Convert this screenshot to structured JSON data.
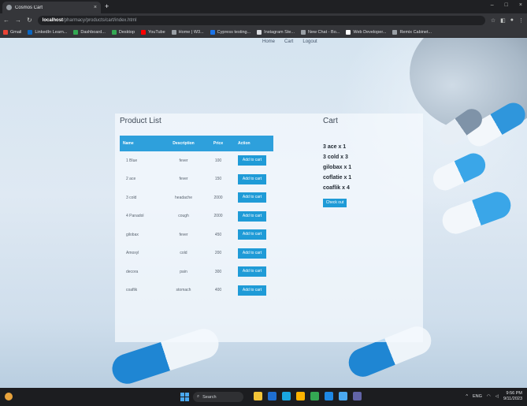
{
  "browser": {
    "tab_title": "Cosmos Cart",
    "tab_close": "×",
    "new_tab": "+",
    "address_host": "localhost",
    "address_path": "/pharmacy/products/cart/index.html",
    "window_controls": [
      "–",
      "□",
      "×"
    ],
    "nav_back": "←",
    "nav_forward": "→",
    "reload": "↻",
    "bookmarks": [
      {
        "label": "Gmail",
        "color": "#ea4335"
      },
      {
        "label": "LinkedIn Learn...",
        "color": "#0a66c2"
      },
      {
        "label": "Dashboard...",
        "color": "#34a853"
      },
      {
        "label": "Desktop",
        "color": "#34a853"
      },
      {
        "label": "YouTube",
        "color": "#ff0000"
      },
      {
        "label": "Home | W3...",
        "color": "#9aa0a6"
      },
      {
        "label": "Cypress testing...",
        "color": "#1a73e8"
      },
      {
        "label": "Instagram Ste...",
        "color": "#dadce0"
      },
      {
        "label": "New Chat - Bo...",
        "color": "#9aa0a6"
      },
      {
        "label": "Web Developer...",
        "color": "#ffffff"
      },
      {
        "label": "Remix Cabinet...",
        "color": "#9aa0a6"
      }
    ]
  },
  "page": {
    "nav": [
      "Home",
      "Cart",
      "Logout"
    ],
    "product_list": {
      "title": "Product List",
      "headers": [
        "Name",
        "Description",
        "Price",
        "Action"
      ],
      "add_label": "Add to cart",
      "rows": [
        {
          "name": "1 Blue",
          "description": "fever",
          "price": "100"
        },
        {
          "name": "2 ace",
          "description": "fever",
          "price": "150"
        },
        {
          "name": "3 cold",
          "description": "headache",
          "price": "2000"
        },
        {
          "name": "4 Panadol",
          "description": "cough",
          "price": "2000"
        },
        {
          "name": "gilobax",
          "description": "fever",
          "price": "450"
        },
        {
          "name": "Amoxyl",
          "description": "cold",
          "price": "200"
        },
        {
          "name": "decora",
          "description": "pain",
          "price": "300"
        },
        {
          "name": "coaflik",
          "description": "stomach",
          "price": "400"
        }
      ]
    },
    "cart": {
      "title": "Cart",
      "items": [
        "3 ace x 1",
        "3 cold x 3",
        "gilobax x 1",
        "coflatie x 1",
        "coaflik x 4"
      ],
      "checkout_label": "Check out"
    }
  },
  "taskbar": {
    "search_placeholder": "Search",
    "time": "9:56 PM",
    "date": "9/11/2023",
    "lang": "ENG",
    "apps": [
      {
        "name": "file-explorer",
        "color": "#f2c438"
      },
      {
        "name": "mail",
        "color": "#1f6fd1"
      },
      {
        "name": "edge",
        "color": "#1aa7e0"
      },
      {
        "name": "store",
        "color": "#ffb300"
      },
      {
        "name": "chrome",
        "color": "#34a853"
      },
      {
        "name": "vscode",
        "color": "#1e88e5"
      },
      {
        "name": "terminal",
        "color": "#4aa8f0"
      },
      {
        "name": "teams",
        "color": "#6264a7"
      }
    ]
  }
}
